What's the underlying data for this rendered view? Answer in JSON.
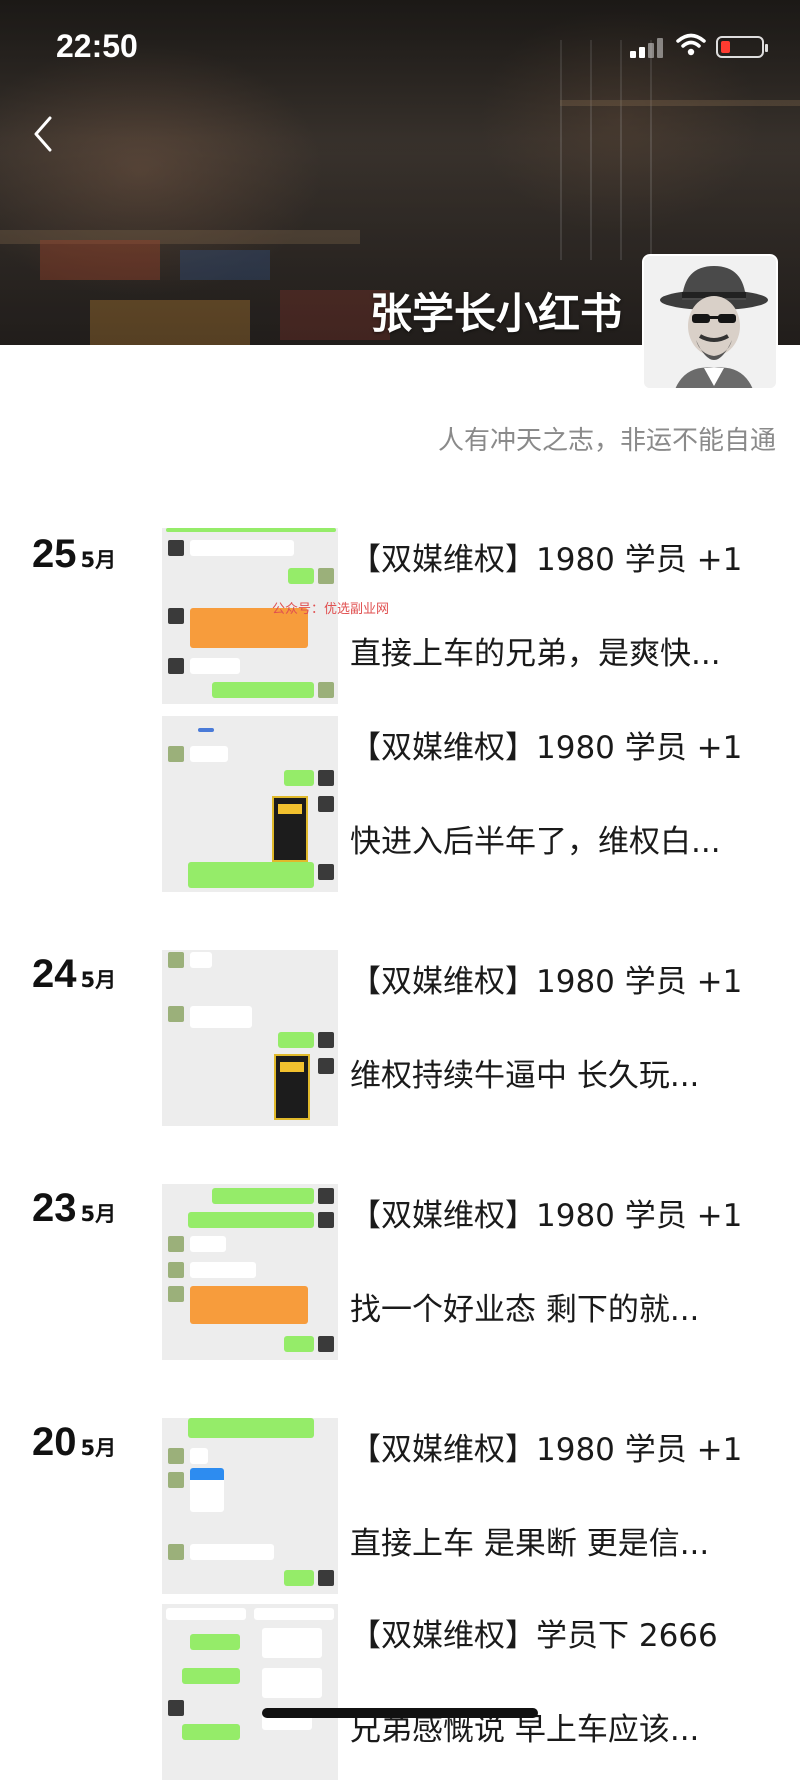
{
  "status_bar": {
    "time": "22:50"
  },
  "profile": {
    "name": "张学长小红书",
    "bio": "人有冲天之志，非运不能自通"
  },
  "watermark": "公众号：优选副业网",
  "feed": [
    {
      "day": "25",
      "month": "5月",
      "posts": [
        {
          "title": "【双媒维权】1980 学员 +1",
          "excerpt": "直接上车的兄弟，是爽快..."
        },
        {
          "title": "【双媒维权】1980 学员 +1",
          "excerpt": "快进入后半年了，维权白..."
        }
      ]
    },
    {
      "day": "24",
      "month": "5月",
      "posts": [
        {
          "title": "【双媒维权】1980 学员 +1",
          "excerpt": "维权持续牛逼中 长久玩..."
        }
      ]
    },
    {
      "day": "23",
      "month": "5月",
      "posts": [
        {
          "title": "【双媒维权】1980 学员 +1",
          "excerpt": "找一个好业态 剩下的就..."
        }
      ]
    },
    {
      "day": "20",
      "month": "5月",
      "posts": [
        {
          "title": "【双媒维权】1980 学员 +1",
          "excerpt": "直接上车 是果断 更是信..."
        },
        {
          "title": "【双媒维权】学员下 2666",
          "excerpt": "兄弟感慨说 早上车应该..."
        }
      ]
    }
  ],
  "colors": {
    "accent_green": "#95ec69",
    "transfer_orange": "#f79c3c",
    "bio_gray": "#8a8a8a"
  },
  "icons": {
    "back": "chevron-left-icon",
    "signal": "signal-icon",
    "wifi": "wifi-icon",
    "battery": "battery-icon"
  }
}
